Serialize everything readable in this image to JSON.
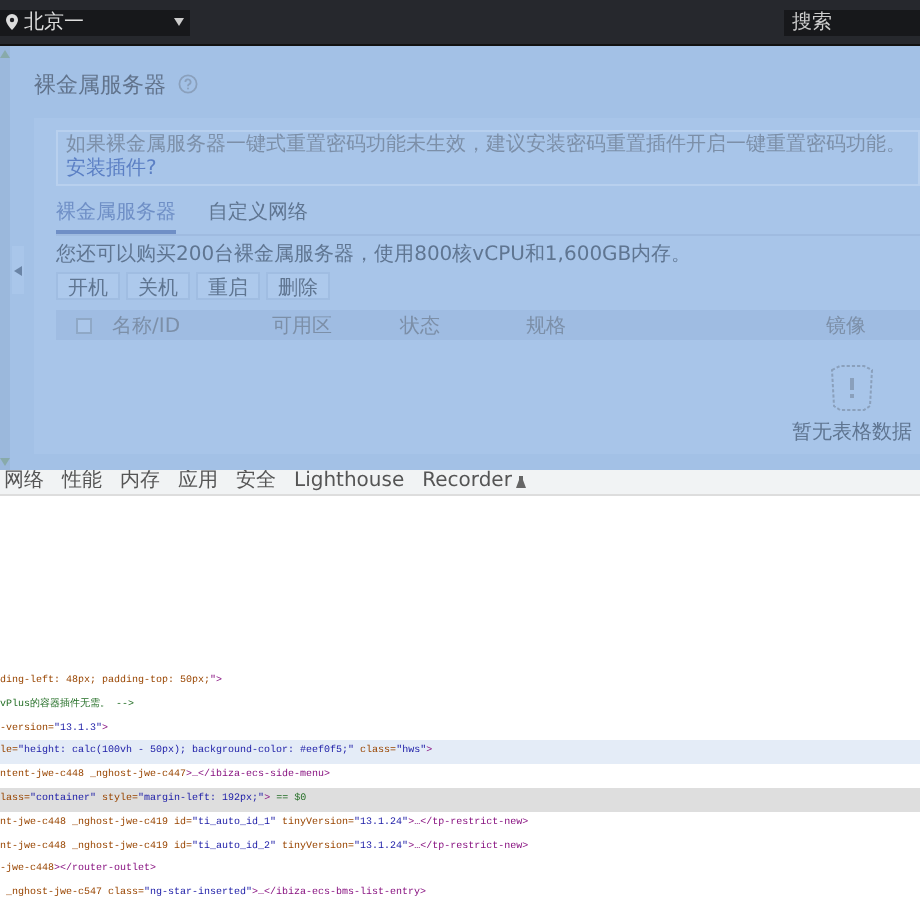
{
  "topbar": {
    "region": "北京一",
    "search": {
      "placeholder": "搜索"
    }
  },
  "page": {
    "title": "裸金属服务器",
    "notice": {
      "text": "如果裸金属服务器一键式重置密码功能未生效，建议安装密码重置插件开启一键重置密码功能。",
      "link": "安装插件?"
    },
    "tabs": [
      {
        "label": "裸金属服务器",
        "selected": true
      },
      {
        "label": "自定义网络",
        "selected": false
      }
    ],
    "quota": "您还可以购买200台裸金属服务器，使用800核vCPU和1,600GB内存。",
    "actions": [
      {
        "label": "开机",
        "disabled": true
      },
      {
        "label": "关机",
        "disabled": true
      },
      {
        "label": "重启",
        "disabled": true
      },
      {
        "label": "删除",
        "disabled": true
      }
    ],
    "table": {
      "select_all": {
        "checked": false
      },
      "columns": [
        "名称/ID",
        "可用区",
        "状态",
        "规格",
        "镜像"
      ],
      "empty": "暂无表格数据"
    }
  },
  "devtools": {
    "tabs": [
      {
        "label": "网络",
        "icon": false
      },
      {
        "label": "性能",
        "icon": false
      },
      {
        "label": "内存",
        "icon": false
      },
      {
        "label": "应用",
        "icon": false
      },
      {
        "label": "安全",
        "icon": false
      },
      {
        "label": "Lighthouse",
        "icon": false
      },
      {
        "label": "Recorder",
        "icon": true
      }
    ],
    "code_lines": [
      {
        "hovered": false,
        "selected": false,
        "parts": [
          {
            "kind": "attr",
            "text": "ding-left: 48px; padding-top: 50px;"
          },
          {
            "kind": "tag",
            "text": "\">"
          }
        ]
      },
      {
        "hovered": false,
        "selected": false,
        "parts": [
          {
            "kind": "comment",
            "text": "vPlus的容器插件无需。 -->"
          }
        ]
      },
      {
        "hovered": false,
        "selected": false,
        "parts": [
          {
            "kind": "attr",
            "text": "-version="
          },
          {
            "kind": "value",
            "text": "\"13.1.3\""
          },
          {
            "kind": "tag",
            "text": ">"
          }
        ]
      },
      {
        "hovered": true,
        "selected": false,
        "parts": [
          {
            "kind": "attr",
            "text": "le="
          },
          {
            "kind": "value",
            "text": "\"height: calc(100vh - 50px); background-color: #eef0f5;\""
          },
          {
            "kind": "attr",
            "text": " class="
          },
          {
            "kind": "value",
            "text": "\"hws\""
          },
          {
            "kind": "tag",
            "text": ">"
          }
        ]
      },
      {
        "hovered": false,
        "selected": false,
        "parts": [
          {
            "kind": "attr",
            "text": "ntent-jwe-c448 _nghost-jwe-c447"
          },
          {
            "kind": "tag",
            "text": ">…</ibiza-ecs-side-menu>"
          }
        ]
      },
      {
        "hovered": false,
        "selected": true,
        "parts": [
          {
            "kind": "attr",
            "text": "lass="
          },
          {
            "kind": "value",
            "text": "\"container\""
          },
          {
            "kind": "attr",
            "text": " style="
          },
          {
            "kind": "value",
            "text": "\"margin-left: 192px;\""
          },
          {
            "kind": "tag",
            "text": ">"
          },
          {
            "kind": "comment",
            "text": " == $0"
          }
        ]
      },
      {
        "hovered": false,
        "selected": false,
        "parts": [
          {
            "kind": "attr",
            "text": "nt-jwe-c448 _nghost-jwe-c419 id="
          },
          {
            "kind": "value",
            "text": "\"ti_auto_id_1\""
          },
          {
            "kind": "attr",
            "text": " tinyVersion="
          },
          {
            "kind": "value",
            "text": "\"13.1.24\""
          },
          {
            "kind": "tag",
            "text": ">…</tp-restrict-new>"
          }
        ]
      },
      {
        "hovered": false,
        "selected": false,
        "parts": [
          {
            "kind": "attr",
            "text": "nt-jwe-c448 _nghost-jwe-c419 id="
          },
          {
            "kind": "value",
            "text": "\"ti_auto_id_2\""
          },
          {
            "kind": "attr",
            "text": " tinyVersion="
          },
          {
            "kind": "value",
            "text": "\"13.1.24\""
          },
          {
            "kind": "tag",
            "text": ">…</tp-restrict-new>"
          }
        ]
      },
      {
        "hovered": false,
        "selected": false,
        "parts": [
          {
            "kind": "attr",
            "text": "-jwe-c448"
          },
          {
            "kind": "tag",
            "text": "></router-outlet>"
          }
        ]
      },
      {
        "hovered": false,
        "selected": false,
        "parts": [
          {
            "kind": "attr",
            "text": " _nghost-jwe-c547 class="
          },
          {
            "kind": "value",
            "text": "\"ng-star-inserted\""
          },
          {
            "kind": "tag",
            "text": ">…</ibiza-ecs-bms-list-entry>"
          }
        ]
      }
    ]
  }
}
